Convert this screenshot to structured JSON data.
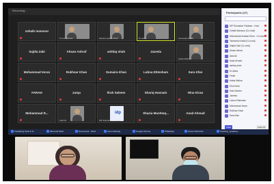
{
  "window": {
    "title": "Recording..."
  },
  "grid": {
    "tiles": [
      {
        "name": "zohaib mansoor",
        "type": "name"
      },
      {
        "name": "",
        "type": "video",
        "caption": "Prof Dr Sohaib"
      },
      {
        "name": "",
        "type": "video",
        "caption": "Muhammad Ali Shah"
      },
      {
        "name": "",
        "type": "video",
        "caption": "Dr Aisha"
      },
      {
        "name": "",
        "type": "video",
        "caption": "Tamseela Khalid"
      },
      {
        "name": "Sajida Zaki",
        "type": "name"
      },
      {
        "name": "Ahsan Ashraf",
        "type": "name"
      },
      {
        "name": "ashfaq shah",
        "type": "name"
      },
      {
        "name": "Jazeela",
        "type": "name"
      },
      {
        "name": "",
        "type": "video",
        "caption": "Hafsa Iftikhar"
      },
      {
        "name": "Mohammad Imran",
        "type": "name"
      },
      {
        "name": "Rukhsar Khan",
        "type": "name"
      },
      {
        "name": "Sumaira Khan",
        "type": "name"
      },
      {
        "name": "Lubna Ehtesham",
        "type": "name"
      },
      {
        "name": "Sara Irfan",
        "type": "name"
      },
      {
        "name": "FARAH",
        "type": "name"
      },
      {
        "name": "zarqa",
        "type": "name"
      },
      {
        "name": "Ifrah Saleem",
        "type": "name"
      },
      {
        "name": "Shariq Hasnain",
        "type": "name"
      },
      {
        "name": "Hina Kiran",
        "type": "name"
      },
      {
        "name": "Mohammad  R...",
        "type": "name"
      },
      {
        "name": "",
        "type": "video",
        "caption": "Abid Ali"
      },
      {
        "name": "",
        "type": "logo",
        "caption": "IDP Education Australia"
      },
      {
        "name": "Shazia  Mushtaq...",
        "type": "name"
      },
      {
        "name": "Asad Ahmad",
        "type": "name"
      }
    ]
  },
  "participants_panel": {
    "title": "Participants (47)",
    "list": [
      "IDP Education Pakistan - Host",
      "Zohaib Mansoor (Co-host)",
      "Muhammad Arsalan Khan - Co-host",
      "Tamseela Khalid (Co-host)",
      "Sajida Zaki (Co-host)",
      "Ahsan Ashraf",
      "Abid Ali",
      "Asad Ahmad",
      "ashfaq shah",
      "Dr Aisha",
      "Farah",
      "Hafsa Iftikhar",
      "Hina Kiran",
      "Ifrah Saleem",
      "Jazeela",
      "Lubna Ehtesham",
      "Mohammad Imran",
      "Rukhsar Khan",
      "Sara Irfan"
    ],
    "invite": "Invite",
    "mute_all": "Mute All"
  },
  "taskbar": {
    "items": [
      "Visualising Tools & D...",
      "Microsoft Word",
      "Document1 - Word",
      "Zoom Meeting",
      "Google Chrome",
      "WhatsApp",
      "Screen Recorder",
      "Teaching_speaking..."
    ]
  }
}
